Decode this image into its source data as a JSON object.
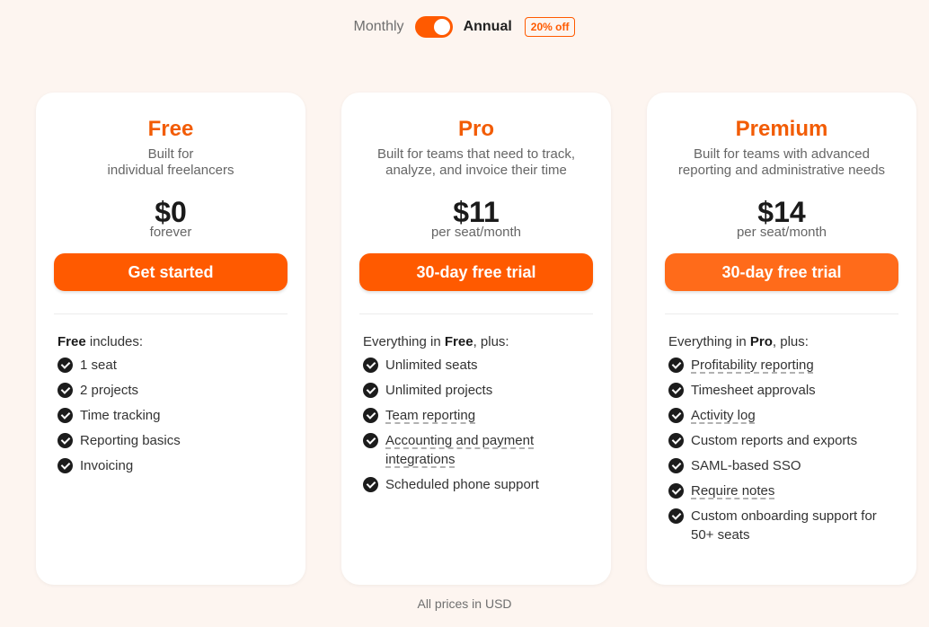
{
  "billing": {
    "monthly_label": "Monthly",
    "annual_label": "Annual",
    "annual_selected": true,
    "discount_badge": "20% off"
  },
  "plans": [
    {
      "name": "Free",
      "description_line1": "Built for",
      "description_line2": "individual freelancers",
      "price": "$0",
      "period": "forever",
      "cta": "Get started",
      "includes_strong": "Free",
      "includes_prefix": "",
      "includes_suffix": " includes:",
      "features": [
        "1 seat",
        "2 projects",
        "Time tracking",
        "Reporting basics",
        "Invoicing"
      ]
    },
    {
      "name": "Pro",
      "description_line1": "Built for teams that need to track,",
      "description_line2": "analyze, and invoice their time",
      "price": "$11",
      "period": "per seat/month",
      "cta": "30-day free trial",
      "includes_prefix": "Everything in ",
      "includes_strong": "Free",
      "includes_suffix": ", plus:",
      "features": [
        "Unlimited seats",
        "Unlimited projects",
        "Team reporting",
        "Accounting and payment integrations",
        "Scheduled phone support"
      ]
    },
    {
      "name": "Premium",
      "description_line1": "Built for teams with advanced",
      "description_line2": "reporting and administrative needs",
      "price": "$14",
      "period": "per seat/month",
      "cta": "30-day free trial",
      "includes_prefix": "Everything in ",
      "includes_strong": "Pro",
      "includes_suffix": ", plus:",
      "features": [
        "Profitability reporting",
        "Timesheet approvals",
        "Activity log",
        "Custom reports and exports",
        "SAML-based SSO",
        "Require notes",
        "Custom onboarding support for 50+ seats"
      ]
    }
  ],
  "footnote": "All prices in USD",
  "colors": {
    "accent": "#ff5a00",
    "plan_name": "#f25c05",
    "background": "#fdf5f0"
  },
  "icons": {
    "feature_check": "check-circle-icon"
  }
}
